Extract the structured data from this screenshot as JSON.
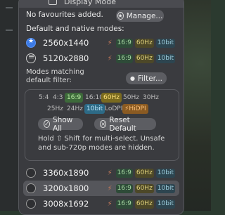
{
  "window": {
    "title": "Display Mode"
  },
  "favourites": {
    "empty_text": "No favourites added.",
    "manage_label": "Manage..."
  },
  "default_section": {
    "heading": "Default and native modes:"
  },
  "default_modes": [
    {
      "label": "2560x1440",
      "tags": [
        "16:9",
        "60Hz",
        "10bit"
      ],
      "selected": true
    },
    {
      "label": "5120x2880",
      "tags": [
        "16:9",
        "60Hz",
        "10bit"
      ],
      "selected": false
    }
  ],
  "filter_section": {
    "heading_line1": "Modes matching",
    "heading_line2": "default filter:",
    "filter_label": "Filter..."
  },
  "filter_chips": {
    "row1": [
      "5:4",
      "4:3",
      "16:9",
      "16:10",
      "60Hz",
      "50Hz",
      "30Hz"
    ],
    "row2": [
      "25Hz",
      "24Hz",
      "10bit",
      "LoDPI",
      "HiDPI"
    ]
  },
  "filter_actions": {
    "show_all": "Show All",
    "reset_default": "Reset Default"
  },
  "help": {
    "line1": "Hold ⇧ Shift for multi-select. Unsafe",
    "line2": "and sub-720p modes are hidden."
  },
  "modes": [
    {
      "label": "3360x1890",
      "tags": [
        "16:9",
        "60Hz",
        "10bit"
      ]
    },
    {
      "label": "3200x1800",
      "tags": [
        "16:9",
        "60Hz",
        "10bit"
      ]
    },
    {
      "label": "3008x1692",
      "tags": [
        "16:9",
        "60Hz",
        "10bit"
      ]
    }
  ]
}
